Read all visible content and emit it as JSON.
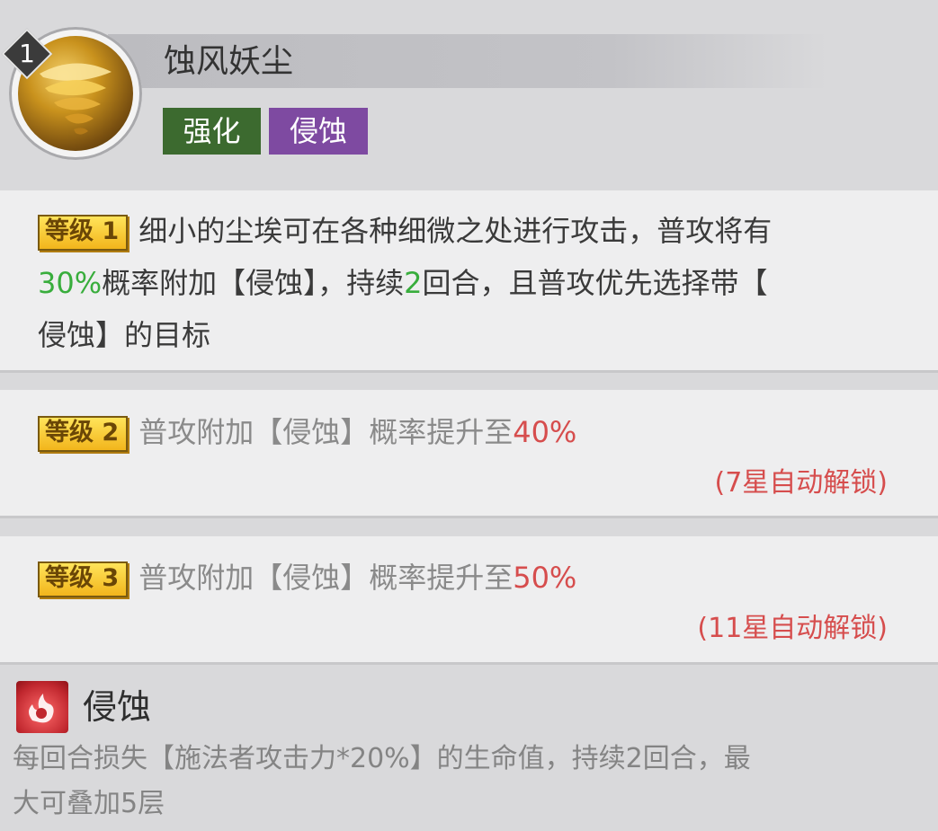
{
  "skill": {
    "level_badge": "1",
    "name": "蚀风妖尘",
    "tags": [
      "强化",
      "侵蚀"
    ]
  },
  "levels": [
    {
      "label": "等级 1",
      "desc_parts": [
        "细小的尘埃可在各种细微之处进行攻击，普攻将有",
        "30%",
        "概率附加【侵蚀】，持续",
        "2",
        "回合，且普攻优先选择带【",
        "侵蚀】的目标"
      ]
    },
    {
      "label": "等级 2",
      "desc": "普攻附加【侵蚀】概率提升至",
      "value": "40%",
      "unlock": "(7星自动解锁)"
    },
    {
      "label": "等级 3",
      "desc": "普攻附加【侵蚀】概率提升至",
      "value": "50%",
      "unlock": "(11星自动解锁)"
    }
  ],
  "status": {
    "icon": "flame-swirl-icon",
    "name": "侵蚀",
    "desc_line1": "每回合损失【施法者攻击力*20%】的生命值，持续2回合，最",
    "desc_line2": "大可叠加5层"
  },
  "colors": {
    "tag_green": "#3c6a2f",
    "tag_purple": "#7e4aa1",
    "highlight_green": "#38ad3c",
    "highlight_red": "#d64d4d"
  }
}
